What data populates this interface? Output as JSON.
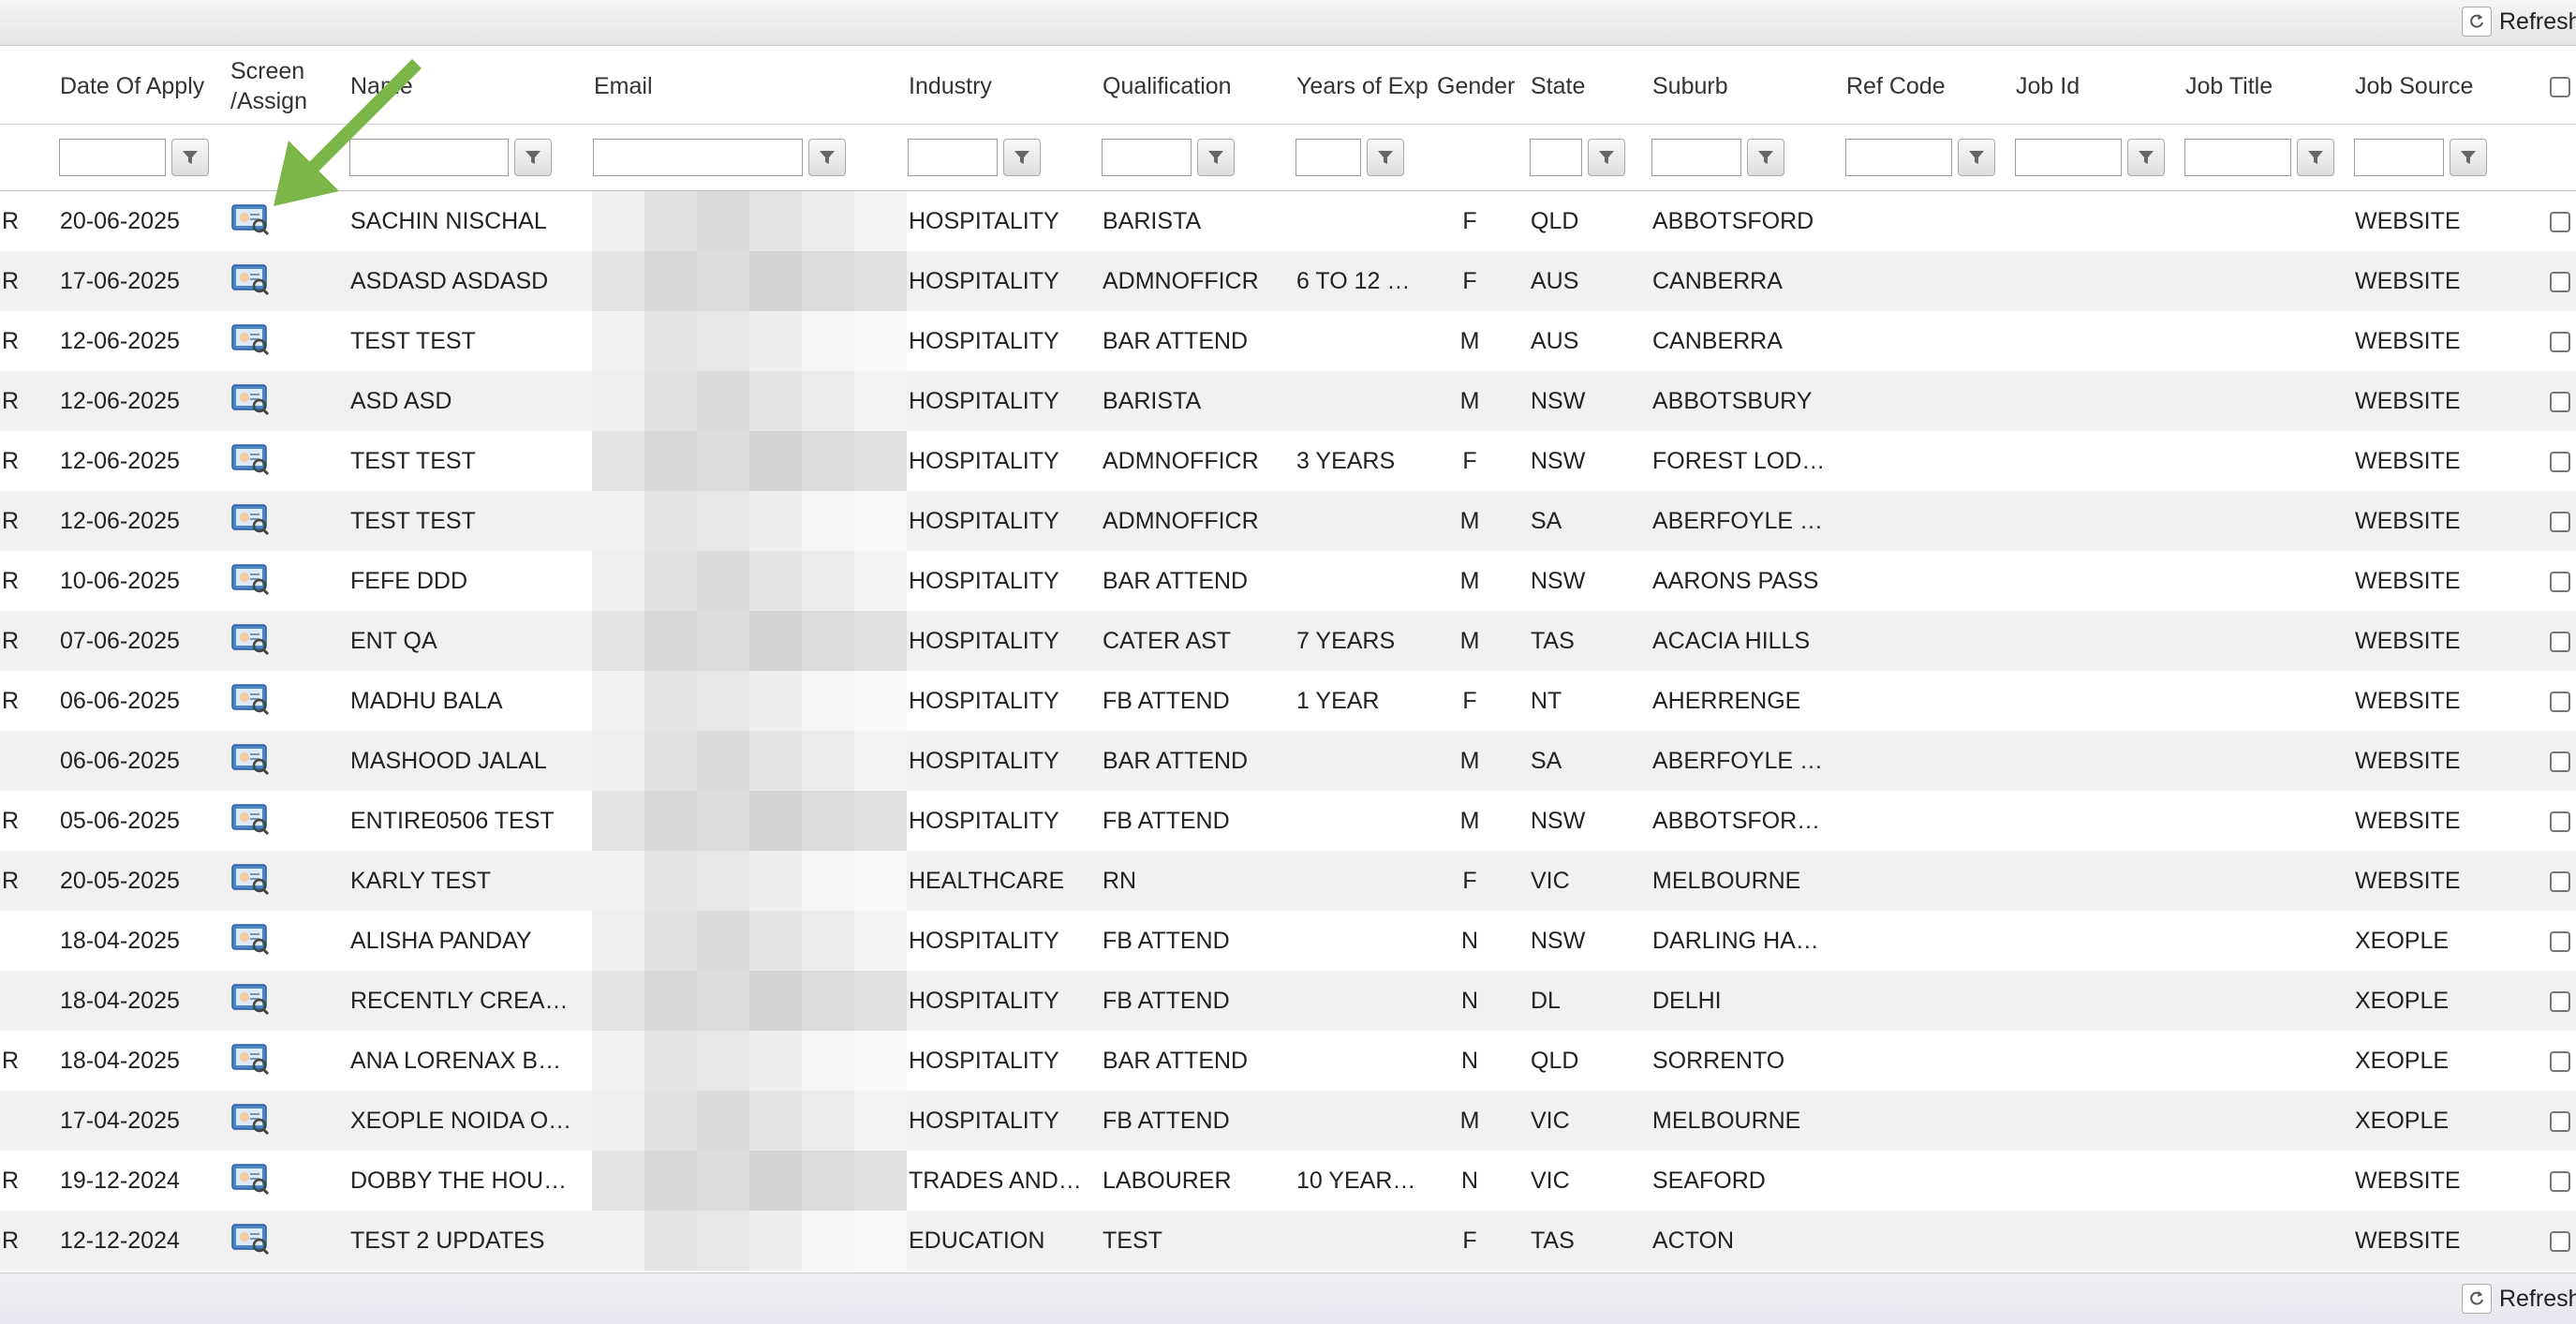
{
  "toolbar": {
    "refresh_label": "Refresh",
    "refresh_icon": "refresh-icon"
  },
  "columns": [
    {
      "key": "flag",
      "label": ""
    },
    {
      "key": "date",
      "label": "Date Of Apply"
    },
    {
      "key": "screen",
      "label": "Screen /Assign"
    },
    {
      "key": "name",
      "label": "Name"
    },
    {
      "key": "email",
      "label": "Email"
    },
    {
      "key": "industry",
      "label": "Industry"
    },
    {
      "key": "qualification",
      "label": "Qualification"
    },
    {
      "key": "years",
      "label": "Years of Exp"
    },
    {
      "key": "gender",
      "label": "Gender"
    },
    {
      "key": "state",
      "label": "State"
    },
    {
      "key": "suburb",
      "label": "Suburb"
    },
    {
      "key": "refcode",
      "label": "Ref Code"
    },
    {
      "key": "jobid",
      "label": "Job Id"
    },
    {
      "key": "jobtitle",
      "label": "Job Title"
    },
    {
      "key": "jobsource",
      "label": "Job Source"
    },
    {
      "key": "select",
      "label": ""
    }
  ],
  "rows": [
    {
      "flag": "R",
      "date": "20-06-2025",
      "name": "SACHIN NISCHAL",
      "industry": "HOSPITALITY",
      "qualification": "BARISTA",
      "years": "",
      "gender": "F",
      "state": "QLD",
      "suburb": "ABBOTSFORD",
      "refcode": "",
      "jobid": "",
      "jobtitle": "",
      "jobsource": "WEBSITE"
    },
    {
      "flag": "R",
      "date": "17-06-2025",
      "name": "ASDASD ASDASD",
      "industry": "HOSPITALITY",
      "qualification": "ADMNOFFICR",
      "years": "6 TO 12 …",
      "gender": "F",
      "state": "AUS",
      "suburb": "CANBERRA",
      "refcode": "",
      "jobid": "",
      "jobtitle": "",
      "jobsource": "WEBSITE"
    },
    {
      "flag": "R",
      "date": "12-06-2025",
      "name": "TEST TEST",
      "industry": "HOSPITALITY",
      "qualification": "BAR ATTEND",
      "years": "",
      "gender": "M",
      "state": "AUS",
      "suburb": "CANBERRA",
      "refcode": "",
      "jobid": "",
      "jobtitle": "",
      "jobsource": "WEBSITE"
    },
    {
      "flag": "R",
      "date": "12-06-2025",
      "name": "ASD ASD",
      "industry": "HOSPITALITY",
      "qualification": "BARISTA",
      "years": "",
      "gender": "M",
      "state": "NSW",
      "suburb": "ABBOTSBURY",
      "refcode": "",
      "jobid": "",
      "jobtitle": "",
      "jobsource": "WEBSITE"
    },
    {
      "flag": "R",
      "date": "12-06-2025",
      "name": "TEST TEST",
      "industry": "HOSPITALITY",
      "qualification": "ADMNOFFICR",
      "years": "3 YEARS",
      "gender": "F",
      "state": "NSW",
      "suburb": "FOREST LOD…",
      "refcode": "",
      "jobid": "",
      "jobtitle": "",
      "jobsource": "WEBSITE"
    },
    {
      "flag": "R",
      "date": "12-06-2025",
      "name": "TEST TEST",
      "industry": "HOSPITALITY",
      "qualification": "ADMNOFFICR",
      "years": "",
      "gender": "M",
      "state": "SA",
      "suburb": "ABERFOYLE …",
      "refcode": "",
      "jobid": "",
      "jobtitle": "",
      "jobsource": "WEBSITE"
    },
    {
      "flag": "R",
      "date": "10-06-2025",
      "name": "FEFE DDD",
      "industry": "HOSPITALITY",
      "qualification": "BAR ATTEND",
      "years": "",
      "gender": "M",
      "state": "NSW",
      "suburb": "AARONS PASS",
      "refcode": "",
      "jobid": "",
      "jobtitle": "",
      "jobsource": "WEBSITE"
    },
    {
      "flag": "R",
      "date": "07-06-2025",
      "name": "ENT QA",
      "industry": "HOSPITALITY",
      "qualification": "CATER AST",
      "years": "7 YEARS",
      "gender": "M",
      "state": "TAS",
      "suburb": "ACACIA HILLS",
      "refcode": "",
      "jobid": "",
      "jobtitle": "",
      "jobsource": "WEBSITE"
    },
    {
      "flag": "R",
      "date": "06-06-2025",
      "name": "MADHU BALA",
      "industry": "HOSPITALITY",
      "qualification": "FB ATTEND",
      "years": "1 YEAR",
      "gender": "F",
      "state": "NT",
      "suburb": "AHERRENGE",
      "refcode": "",
      "jobid": "",
      "jobtitle": "",
      "jobsource": "WEBSITE"
    },
    {
      "flag": "",
      "date": "06-06-2025",
      "name": "MASHOOD JALAL",
      "industry": "HOSPITALITY",
      "qualification": "BAR ATTEND",
      "years": "",
      "gender": "M",
      "state": "SA",
      "suburb": "ABERFOYLE …",
      "refcode": "",
      "jobid": "",
      "jobtitle": "",
      "jobsource": "WEBSITE"
    },
    {
      "flag": "R",
      "date": "05-06-2025",
      "name": "ENTIRE0506 TEST",
      "industry": "HOSPITALITY",
      "qualification": "FB ATTEND",
      "years": "",
      "gender": "M",
      "state": "NSW",
      "suburb": "ABBOTSFOR…",
      "refcode": "",
      "jobid": "",
      "jobtitle": "",
      "jobsource": "WEBSITE"
    },
    {
      "flag": "R",
      "date": "20-05-2025",
      "name": "KARLY TEST",
      "industry": "HEALTHCARE",
      "qualification": "RN",
      "years": "",
      "gender": "F",
      "state": "VIC",
      "suburb": "MELBOURNE",
      "refcode": "",
      "jobid": "",
      "jobtitle": "",
      "jobsource": "WEBSITE"
    },
    {
      "flag": "",
      "date": "18-04-2025",
      "name": "ALISHA PANDAY",
      "industry": "HOSPITALITY",
      "qualification": "FB ATTEND",
      "years": "",
      "gender": "N",
      "state": "NSW",
      "suburb": "DARLING HA…",
      "refcode": "",
      "jobid": "",
      "jobtitle": "",
      "jobsource": "XEOPLE"
    },
    {
      "flag": "",
      "date": "18-04-2025",
      "name": "RECENTLY CREA…",
      "industry": "HOSPITALITY",
      "qualification": "FB ATTEND",
      "years": "",
      "gender": "N",
      "state": "DL",
      "suburb": "DELHI",
      "refcode": "",
      "jobid": "",
      "jobtitle": "",
      "jobsource": "XEOPLE"
    },
    {
      "flag": "R",
      "date": "18-04-2025",
      "name": "ANA LORENAX B…",
      "industry": "HOSPITALITY",
      "qualification": "BAR ATTEND",
      "years": "",
      "gender": "N",
      "state": "QLD",
      "suburb": "SORRENTO",
      "refcode": "",
      "jobid": "",
      "jobtitle": "",
      "jobsource": "XEOPLE"
    },
    {
      "flag": "",
      "date": "17-04-2025",
      "name": "XEOPLE NOIDA O…",
      "industry": "HOSPITALITY",
      "qualification": "FB ATTEND",
      "years": "",
      "gender": "M",
      "state": "VIC",
      "suburb": "MELBOURNE",
      "refcode": "",
      "jobid": "",
      "jobtitle": "",
      "jobsource": "XEOPLE"
    },
    {
      "flag": "R",
      "date": "19-12-2024",
      "name": "DOBBY THE HOU…",
      "industry": "TRADES AND…",
      "qualification": "LABOURER",
      "years": "10 YEAR…",
      "gender": "N",
      "state": "VIC",
      "suburb": "SEAFORD",
      "refcode": "",
      "jobid": "",
      "jobtitle": "",
      "jobsource": "WEBSITE"
    },
    {
      "flag": "R",
      "date": "12-12-2024",
      "name": "TEST 2 UPDATES",
      "industry": "EDUCATION",
      "qualification": "TEST",
      "years": "",
      "gender": "F",
      "state": "TAS",
      "suburb": "ACTON",
      "refcode": "",
      "jobid": "",
      "jobtitle": "",
      "jobsource": "WEBSITE"
    }
  ],
  "icons": {
    "screen_assign": "screen-assign-icon",
    "filter": "filter-icon",
    "annotation_arrow": "arrow-annotation-icon"
  },
  "colors": {
    "arrow": "#7ab648",
    "row_alt": "#f1f1f1",
    "email_blur": "#e6e6e6"
  }
}
